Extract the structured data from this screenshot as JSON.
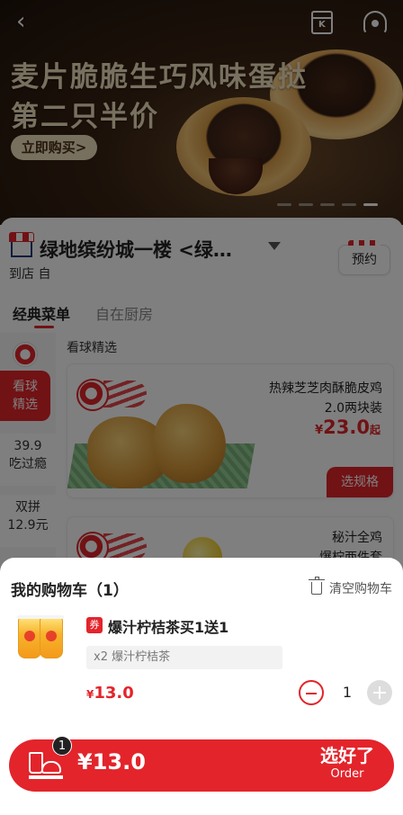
{
  "banner": {
    "title_line1": "麦片脆脆生巧风味蛋挞",
    "title_line2": "第二只半价",
    "buy_label": "立即购买>",
    "calendar_icon_text": "K",
    "slide_count": 5,
    "active_slide": 4
  },
  "store": {
    "name": "绿地缤纷城一楼 <绿…",
    "mode": "到店 自",
    "reserve_label": "预约"
  },
  "tabs": [
    {
      "label": "经典菜单",
      "active": true
    },
    {
      "label": "自在厨房",
      "active": false
    }
  ],
  "sidebar": {
    "items": [
      {
        "label_line1": "看球",
        "label_line2": "精选",
        "active": true
      },
      {
        "label_line1": "39.9",
        "label_line2": "吃过瘾",
        "active": false
      },
      {
        "label_line1": "双拼",
        "label_line2": "12.9元",
        "active": false
      }
    ]
  },
  "menu": {
    "section_title": "看球精选",
    "products": [
      {
        "name_line1": "热辣芝芝肉酥脆皮鸡",
        "name_line2": "2.0两块装",
        "price_currency": "¥",
        "price": "23.0",
        "price_suffix": "起",
        "action_label": "选规格"
      },
      {
        "name_line1": "秘汁全鸡",
        "name_line2": "爆柠两件套"
      }
    ]
  },
  "cart": {
    "title": "我的购物车（1）",
    "clear_label": "清空购物车",
    "items": [
      {
        "coupon_tag": "券",
        "name": "爆汁柠桔茶买1送1",
        "detail": "x2 爆汁柠桔茶",
        "price_currency": "¥",
        "price": "13.0",
        "quantity": "1"
      }
    ]
  },
  "checkout": {
    "badge_count": "1",
    "total": "¥13.0",
    "order_label_zh": "选好了",
    "order_label_en": "Order"
  },
  "colors": {
    "brand_red": "#e3242b",
    "overlay": "rgba(0,0,0,0.5)"
  }
}
